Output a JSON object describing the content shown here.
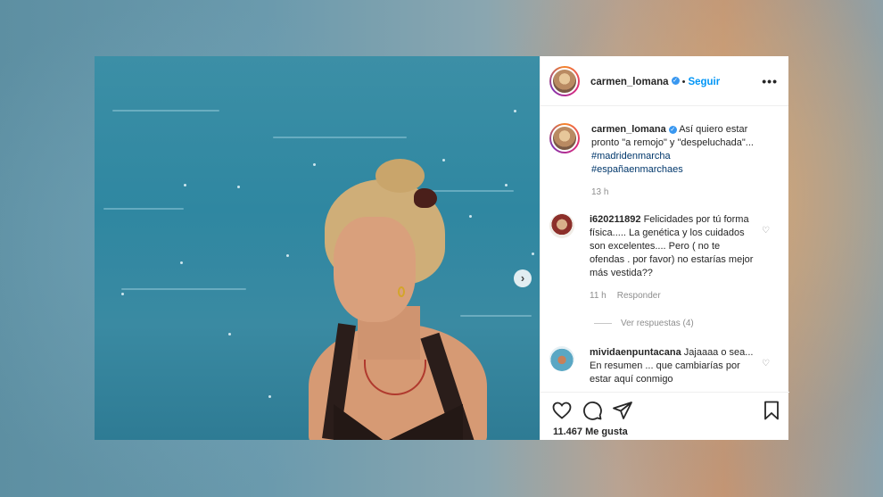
{
  "post": {
    "author": "carmen_lomana",
    "follow_label": "Seguir",
    "more_label": "•••",
    "caption": {
      "username": "carmen_lomana",
      "text": "Así quiero estar pronto \"a remojo\" y \"despeluchada\"...",
      "hashtags": [
        "#madridenmarcha",
        "#españaenmarchaes"
      ],
      "time": "13 h"
    },
    "comments": [
      {
        "username": "i620211892",
        "text": "Felicidades por tú forma física..... La genética y los cuidados son excelentes.... Pero ( no te ofendas . por favor) no estarías mejor más vestida??",
        "time": "11 h",
        "reply_label": "Responder",
        "view_replies": "Ver respuestas (4)"
      },
      {
        "username": "mividaenpuntacana",
        "text": "Jajaaaa o sea... En resumen ... que cambiarías por estar aquí conmigo"
      }
    ],
    "likes": "11.467 Me gusta",
    "next_icon": "chevron-right-icon",
    "verified_icon": "verified-badge-icon"
  },
  "colors": {
    "follow": "#0095f6",
    "verified": "#3897f0",
    "text": "#262626",
    "muted": "#8e8e8e",
    "sea": "#2f87a1"
  }
}
